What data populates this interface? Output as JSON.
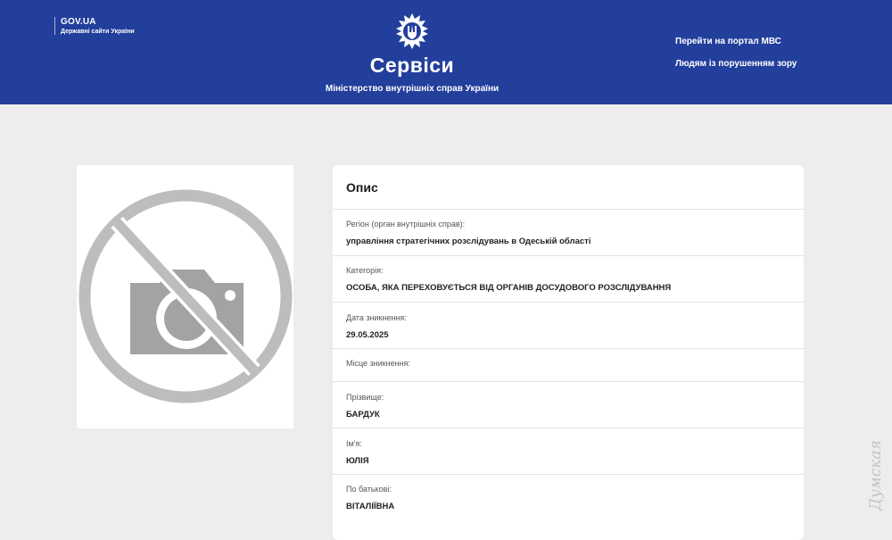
{
  "header": {
    "gov_title": "GOV.UA",
    "gov_subtitle": "Державні сайти України",
    "brand": "Сервіси",
    "ministry": "Міністерство внутрішніх справ України",
    "links": [
      "Перейти на портал МВС",
      "Людям із порушенням зору"
    ],
    "background_color": "#233f9c"
  },
  "photo": {
    "icon": "no-photo-icon"
  },
  "card": {
    "title": "Опис",
    "fields": [
      {
        "label": "Регіон (орган внутрішніх справ):",
        "value": "управління стратегічних розслідувань в Одеській області"
      },
      {
        "label": "Категорія:",
        "value": "ОСОБА, ЯКА ПЕРЕХОВУЄТЬСЯ ВІД ОРГАНІВ ДОСУДОВОГО РОЗСЛІДУВАННЯ"
      },
      {
        "label": "Дата зникнення:",
        "value": "29.05.2025"
      },
      {
        "label": "Місце зникнення:",
        "value": ""
      },
      {
        "label": "Прізвище:",
        "value": "БАРДУК"
      },
      {
        "label": "Ім'я:",
        "value": "ЮЛІЯ"
      },
      {
        "label": "По батькові:",
        "value": "ВІТАЛІЇВНА"
      }
    ]
  },
  "watermark": "Думская"
}
